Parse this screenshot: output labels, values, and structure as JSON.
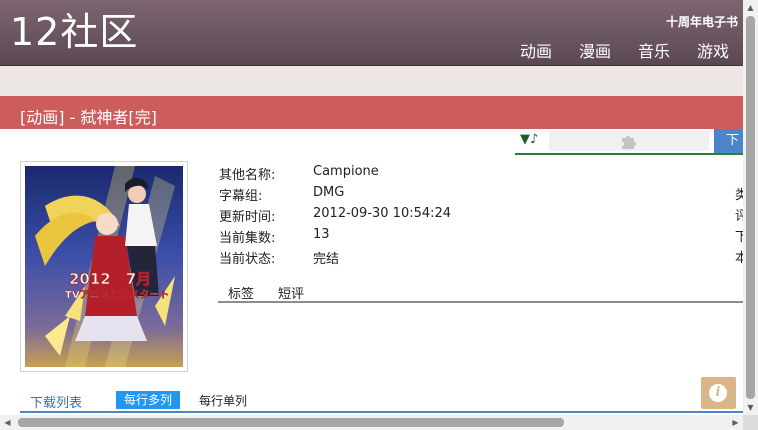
{
  "header": {
    "logo": "12社区",
    "anniversary_link": "十周年电子书",
    "nav": [
      "动画",
      "漫画",
      "音乐",
      "游戏"
    ]
  },
  "title_bar": {
    "title": "[动画] - 弑神者[完]"
  },
  "download_toolbar": {
    "left_label": "▼♪",
    "right_label": "下",
    "icon": "puzzle-piece-icon"
  },
  "poster": {
    "caption_year": "2012年7月",
    "caption_line": "TVアニメ放送スタート"
  },
  "info": [
    {
      "key": "其他名称:",
      "value": "Campione"
    },
    {
      "key": "字幕组:",
      "value": "DMG"
    },
    {
      "key": "更新时间:",
      "value": "2012-09-30 10:54:24"
    },
    {
      "key": "当前集数:",
      "value": "13"
    },
    {
      "key": "当前状态:",
      "value": "完结"
    }
  ],
  "right_labels": [
    "类",
    "评",
    "下",
    "本"
  ],
  "tags": [
    "标签",
    "短评"
  ],
  "list_tabs": {
    "title": "下载列表",
    "active": "每行多列",
    "alt": "每行单列"
  },
  "info_button": "i",
  "colors": {
    "header": "#6a5660",
    "title_bar": "#cd5c5c",
    "accent_blue": "#2196f3",
    "toolbar_green": "#2e7d32"
  }
}
